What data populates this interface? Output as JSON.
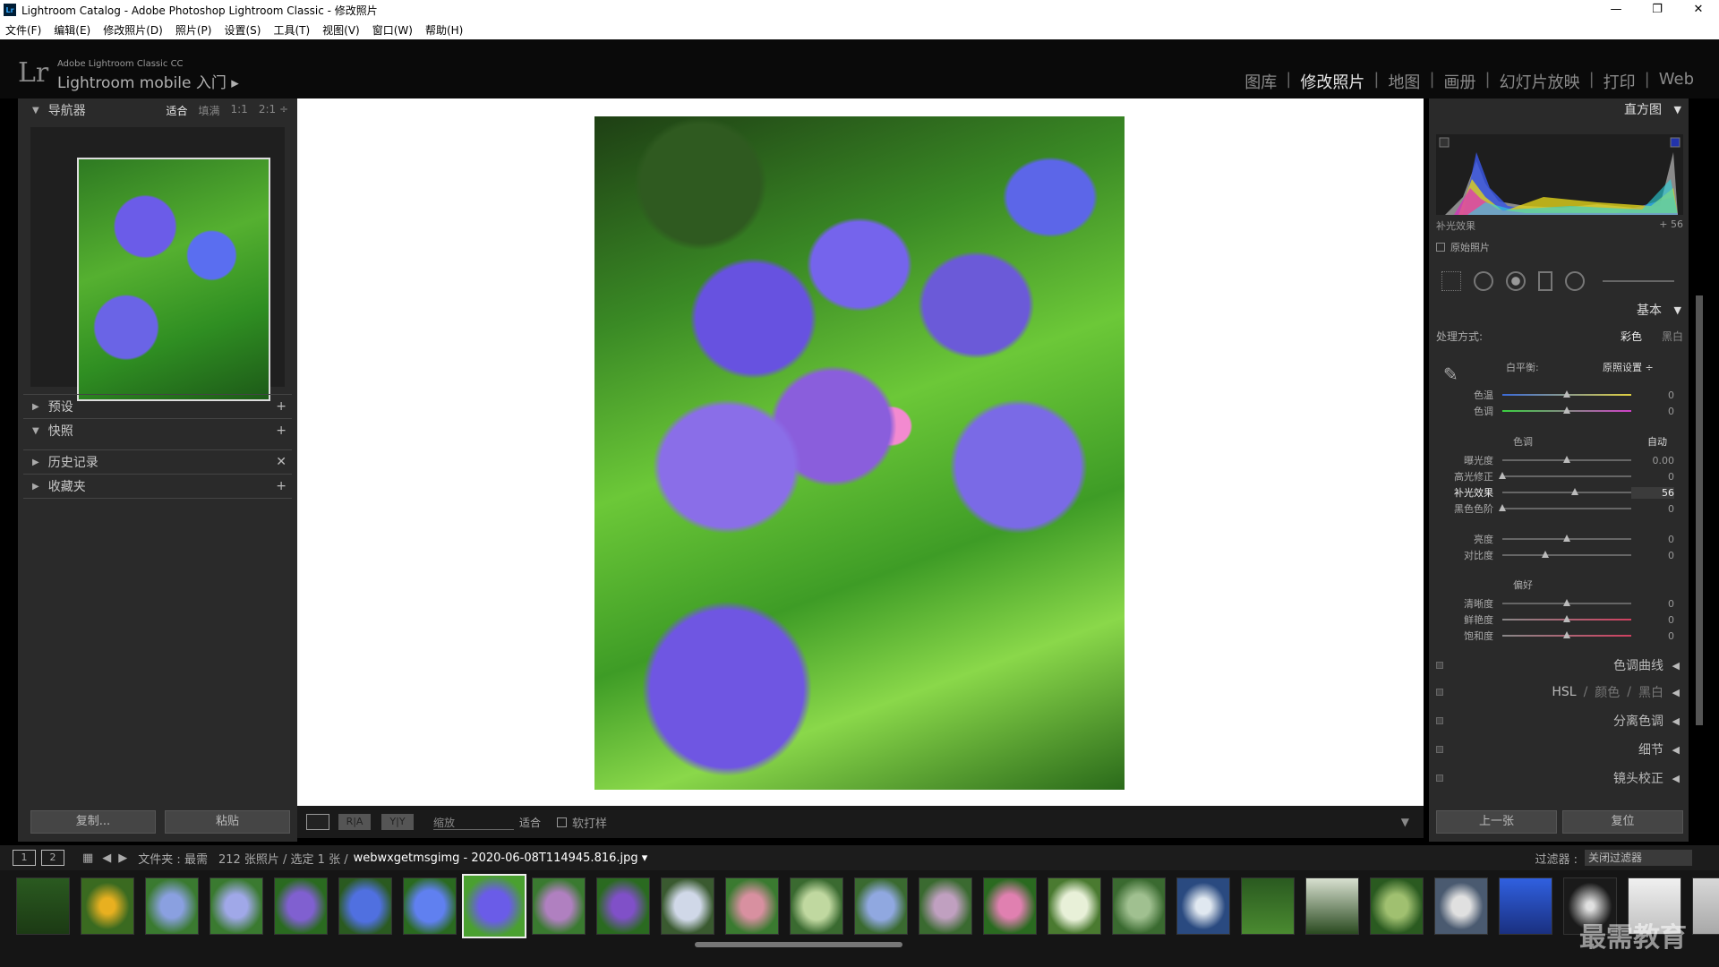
{
  "window": {
    "title": "Lightroom Catalog - Adobe Photoshop Lightroom Classic - 修改照片",
    "logo": "Lr",
    "controls": [
      "—",
      "❐",
      "✕"
    ]
  },
  "menu": [
    "文件(F)",
    "编辑(E)",
    "修改照片(D)",
    "照片(P)",
    "设置(S)",
    "工具(T)",
    "视图(V)",
    "窗口(W)",
    "帮助(H)"
  ],
  "identity": {
    "mark": "Lr",
    "small": "Adobe Lightroom Classic CC",
    "big": "Lightroom mobile 入门  ▸"
  },
  "modules": [
    {
      "label": "图库",
      "active": false
    },
    {
      "label": "修改照片",
      "active": true
    },
    {
      "label": "地图",
      "active": false
    },
    {
      "label": "画册",
      "active": false
    },
    {
      "label": "幻灯片放映",
      "active": false
    },
    {
      "label": "打印",
      "active": false
    },
    {
      "label": "Web",
      "active": false
    }
  ],
  "left": {
    "navigator": {
      "title": "导航器",
      "options": [
        "适合",
        "填满",
        "1:1",
        "2:1 ÷"
      ]
    },
    "sections": [
      {
        "label": "预设",
        "action": "+"
      },
      {
        "label": "快照",
        "action": "+"
      },
      {
        "label": "历史记录",
        "action": "✕"
      },
      {
        "label": "收藏夹",
        "action": "+"
      }
    ],
    "copy_btn": "复制...",
    "paste_btn": "粘贴"
  },
  "toolbar": {
    "zoom_label": "缩放",
    "fit_label": "适合",
    "soft_proof": "软打样",
    "view_ra": "R|A",
    "view_yy": "Y|Y"
  },
  "right": {
    "histogram_title": "直方图",
    "hist_info_left": "补光效果",
    "hist_info_right": "+ 56",
    "original": "原始照片",
    "basic_title": "基本",
    "treatment_label": "处理方式:",
    "treatment_color": "彩色",
    "treatment_bw": "黑白",
    "wb_label": "白平衡:",
    "wb_value": "原照设置 ÷",
    "tone_label": "色调",
    "auto_label": "自动",
    "presence_label": "偏好",
    "sliders": [
      {
        "label": "色温",
        "value": "0",
        "pos": 0.5
      },
      {
        "label": "色调",
        "value": "0",
        "pos": 0.5
      },
      {
        "label": "曝光度",
        "value": "0.00",
        "pos": 0.5
      },
      {
        "label": "高光修正",
        "value": "0",
        "pos": 0.0
      },
      {
        "label": "补光效果",
        "value": "56",
        "pos": 0.56
      },
      {
        "label": "黑色色阶",
        "value": "0",
        "pos": 0.0
      },
      {
        "label": "亮度",
        "value": "0",
        "pos": 0.5
      },
      {
        "label": "对比度",
        "value": "0",
        "pos": 0.33
      },
      {
        "label": "清晰度",
        "value": "0",
        "pos": 0.5
      },
      {
        "label": "鲜艳度",
        "value": "0",
        "pos": 0.5
      },
      {
        "label": "饱和度",
        "value": "0",
        "pos": 0.5
      }
    ],
    "sections": {
      "tone_curve": "色调曲线",
      "hsl": "HSL",
      "color": "颜色",
      "bw": "黑白",
      "split": "分离色调",
      "detail": "细节",
      "lens": "镜头校正"
    },
    "prev_btn": "上一张",
    "reset_btn": "复位"
  },
  "filmbar": {
    "page1": "1",
    "page2": "2",
    "folder": "文件夹 : 最需",
    "count": "212 张照片 / 选定 1 张 /",
    "filename": "webwxgetmsgimg - 2020-06-08T114945.816.jpg ▾",
    "filter_label": "过滤器 :",
    "filter_value": "关闭过滤器"
  },
  "watermark": "最需教育",
  "colors": {
    "panel_bg": "#2a2a2a",
    "accent": "#ffffff"
  }
}
